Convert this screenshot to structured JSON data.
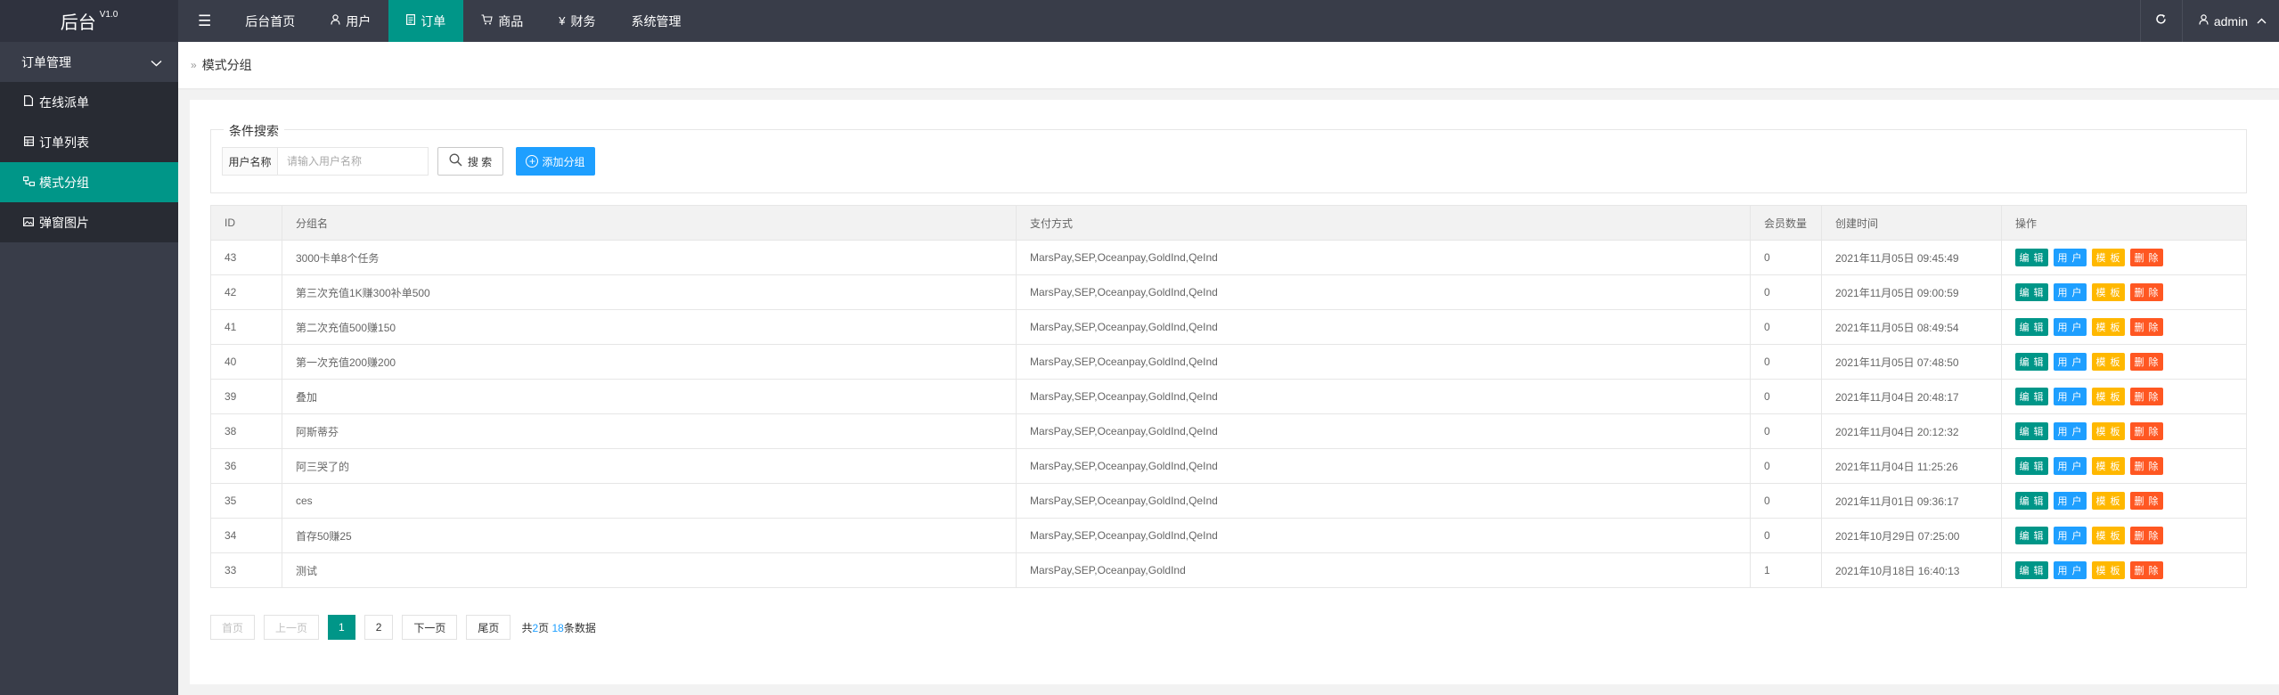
{
  "app": {
    "logo": "后台",
    "version": "V1.0"
  },
  "topnav": {
    "items": [
      {
        "label": "后台首页",
        "icon": ""
      },
      {
        "label": "用户",
        "icon": "user-icon"
      },
      {
        "label": "订单",
        "icon": "document-icon"
      },
      {
        "label": "商品",
        "icon": "cart-icon"
      },
      {
        "label": "财务",
        "icon": "yen-icon"
      },
      {
        "label": "系统管理",
        "icon": ""
      }
    ],
    "active_index": 2,
    "menu_icon": "hamburger-icon",
    "refresh_icon": "refresh-icon",
    "user_label": "admin"
  },
  "sidebar": {
    "section": "订单管理",
    "items": [
      {
        "label": "在线派单",
        "icon": "file-icon"
      },
      {
        "label": "订单列表",
        "icon": "list-icon"
      },
      {
        "label": "模式分组",
        "icon": "group-icon"
      },
      {
        "label": "弹窗图片",
        "icon": "image-icon"
      }
    ],
    "active_index": 2
  },
  "breadcrumb": {
    "current": "模式分组"
  },
  "search": {
    "legend": "条件搜索",
    "field_label": "用户名称",
    "placeholder": "请输入用户名称",
    "value": "",
    "search_label": "搜 索",
    "add_label": "添加分组"
  },
  "table": {
    "headers": [
      "ID",
      "分组名",
      "支付方式",
      "会员数量",
      "创建时间",
      "操作"
    ],
    "actions": [
      "编 辑",
      "用 户",
      "模 板",
      "删 除"
    ],
    "rows": [
      {
        "id": "43",
        "name": "3000卡单8个任务",
        "pay": "MarsPay,SEP,Oceanpay,GoldInd,QeInd",
        "members": "0",
        "created": "2021年11月05日 09:45:49"
      },
      {
        "id": "42",
        "name": "第三次充值1K赚300补单500",
        "pay": "MarsPay,SEP,Oceanpay,GoldInd,QeInd",
        "members": "0",
        "created": "2021年11月05日 09:00:59"
      },
      {
        "id": "41",
        "name": "第二次充值500赚150",
        "pay": "MarsPay,SEP,Oceanpay,GoldInd,QeInd",
        "members": "0",
        "created": "2021年11月05日 08:49:54"
      },
      {
        "id": "40",
        "name": "第一次充值200赚200",
        "pay": "MarsPay,SEP,Oceanpay,GoldInd,QeInd",
        "members": "0",
        "created": "2021年11月05日 07:48:50"
      },
      {
        "id": "39",
        "name": "叠加",
        "pay": "MarsPay,SEP,Oceanpay,GoldInd,QeInd",
        "members": "0",
        "created": "2021年11月04日 20:48:17"
      },
      {
        "id": "38",
        "name": "阿斯蒂芬",
        "pay": "MarsPay,SEP,Oceanpay,GoldInd,QeInd",
        "members": "0",
        "created": "2021年11月04日 20:12:32"
      },
      {
        "id": "36",
        "name": "阿三哭了的",
        "pay": "MarsPay,SEP,Oceanpay,GoldInd,QeInd",
        "members": "0",
        "created": "2021年11月04日 11:25:26"
      },
      {
        "id": "35",
        "name": "ces",
        "pay": "MarsPay,SEP,Oceanpay,GoldInd,QeInd",
        "members": "0",
        "created": "2021年11月01日 09:36:17"
      },
      {
        "id": "34",
        "name": "首存50赚25",
        "pay": "MarsPay,SEP,Oceanpay,GoldInd,QeInd",
        "members": "0",
        "created": "2021年10月29日 07:25:00"
      },
      {
        "id": "33",
        "name": "测试",
        "pay": "MarsPay,SEP,Oceanpay,GoldInd",
        "members": "1",
        "created": "2021年10月18日 16:40:13"
      }
    ]
  },
  "pager": {
    "first": "首页",
    "prev": "上一页",
    "pages": [
      "1",
      "2"
    ],
    "current": "1",
    "next": "下一页",
    "last": "尾页",
    "info_prefix": "共",
    "total_pages": "2",
    "info_mid": "页 ",
    "total_items": "18",
    "info_suffix": "条数据"
  },
  "colors": {
    "accent": "#009688",
    "blue": "#1e9fff",
    "yellow": "#ffb800",
    "red": "#ff5722",
    "dark": "#393d49"
  }
}
